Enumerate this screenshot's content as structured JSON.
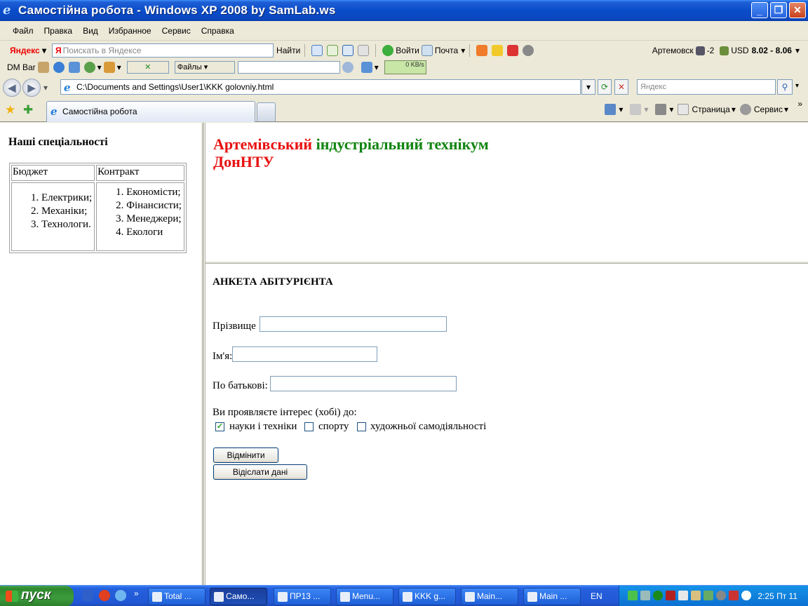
{
  "window": {
    "title": "Самостійна робота - Windows XP 2008 by SamLab.ws",
    "minimize": "_",
    "maximize": "❐",
    "close": "✕"
  },
  "menu": [
    "Файл",
    "Правка",
    "Вид",
    "Избранное",
    "Сервис",
    "Справка"
  ],
  "yandex_bar": {
    "logo": "Яндекс",
    "search_placeholder": "Поискать в Яндексе",
    "find_label": "Найти",
    "login_label": "Войти",
    "mail_label": "Почта",
    "city": "Артемовск",
    "temp": "-2",
    "usd_label": "USD",
    "usd_rate": "8.02 - 8.06"
  },
  "dm_bar": {
    "label": "DM Bar",
    "files_label": "Файлы",
    "speed": "0 KB/s"
  },
  "address_bar": {
    "url": "C:\\Documents and Settings\\User1\\KKK golovniy.html",
    "search_placeholder": "Яндекс"
  },
  "tabs": {
    "active_tab_label": "Самостійна робота",
    "page_label": "Страница",
    "service_label": "Сервис",
    "more": "»"
  },
  "left_frame": {
    "title": "Наші спеціальності",
    "columns": [
      "Бюджет",
      "Контракт"
    ],
    "budget": [
      "Електрики;",
      "Механіки;",
      "Технологи."
    ],
    "contract": [
      "Економісти;",
      "Фінансисти;",
      "Менеджери;",
      "Екологи"
    ]
  },
  "header_frame": {
    "title_part1": "Артемівський",
    "title_part2": "індустріальний технікум",
    "title_part3": "ДонНТУ",
    "color_red": "#e81010",
    "color_green": "#108410"
  },
  "form": {
    "title": "АНКЕТА АБІТУРІЄНТА",
    "surname_label": "Прізвище",
    "name_label": "Ім'я:",
    "patronymic_label": "По батькові:",
    "surname_value": "",
    "name_value": "",
    "patronymic_value": "",
    "hobby_question": "Ви проявляєте інтерес (хобі) до:",
    "hobbies": [
      {
        "label": "науки і техніки",
        "checked": true
      },
      {
        "label": "спорту",
        "checked": false
      },
      {
        "label": "художньої самодіяльності",
        "checked": false
      }
    ],
    "reset_button": "Відмінити",
    "submit_button": "Відіслати дані"
  },
  "taskbar": {
    "start_label": "пуск",
    "tasks": [
      "Total ...",
      "Само...",
      "ПР13 ...",
      "Menu...",
      "KKK g...",
      "Main...",
      "Main ..."
    ],
    "lang": "EN",
    "clock": "2:25 Пт 11"
  }
}
